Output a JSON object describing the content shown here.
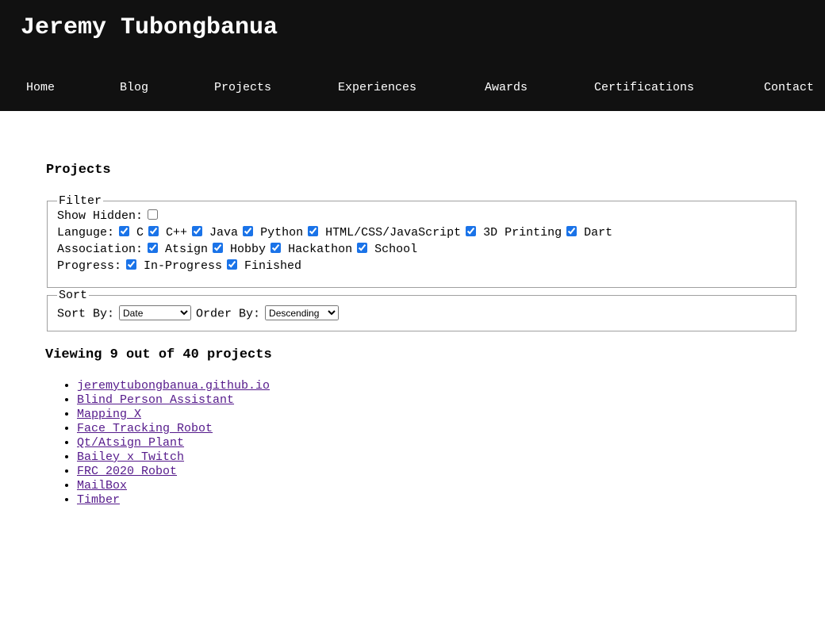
{
  "site": {
    "title": "Jeremy Tubongbanua"
  },
  "nav": [
    {
      "label": "Home"
    },
    {
      "label": "Blog"
    },
    {
      "label": "Projects"
    },
    {
      "label": "Experiences"
    },
    {
      "label": "Awards"
    },
    {
      "label": "Certifications"
    },
    {
      "label": "Contact"
    }
  ],
  "page": {
    "title": "Projects"
  },
  "filter": {
    "legend": "Filter",
    "show_hidden_label": "Show Hidden:",
    "show_hidden_checked": false,
    "language_label": "Languge:",
    "languages": [
      "C",
      "C++",
      "Java",
      "Python",
      "HTML/CSS/JavaScript",
      "3D Printing",
      "Dart"
    ],
    "association_label": "Association:",
    "associations": [
      "Atsign",
      "Hobby",
      "Hackathon",
      "School"
    ],
    "progress_label": "Progress:",
    "progress": [
      "In-Progress",
      "Finished"
    ]
  },
  "sort": {
    "legend": "Sort",
    "sort_by_label": "Sort By:",
    "sort_by_value": "Date",
    "order_by_label": "Order By:",
    "order_by_value": "Descending"
  },
  "results": {
    "count_text": "Viewing 9 out of 40 projects"
  },
  "projects": [
    "jeremytubongbanua.github.io",
    "Blind Person Assistant",
    "Mapping X",
    "Face Tracking Robot",
    "Qt/Atsign Plant",
    "Bailey x Twitch",
    "FRC 2020 Robot",
    "MailBox",
    "Timber"
  ],
  "colors": {
    "header_bg": "#111111",
    "link_visited": "#551a8b",
    "checkbox_accent": "#1a73e8"
  }
}
